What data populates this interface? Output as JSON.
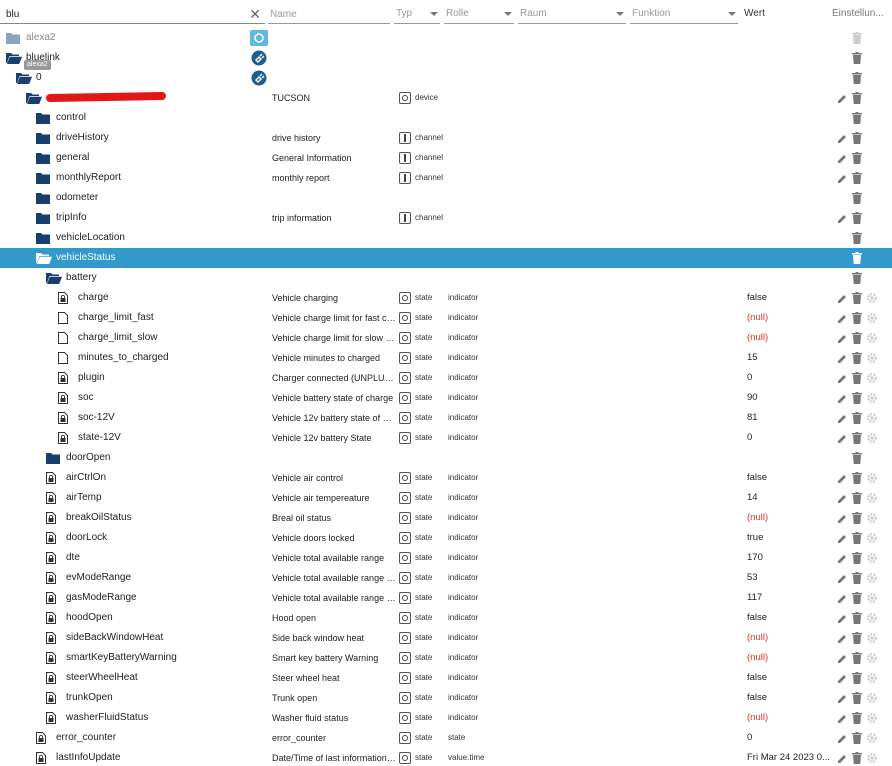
{
  "header": {
    "search_value": "blu",
    "clear": "✕",
    "name_placeholder": "Name",
    "typ": "Typ",
    "rolle": "Rolle",
    "raum": "Raum",
    "funktion": "Funktion",
    "wert": "Wert",
    "einstellungen": "Einstellun..."
  },
  "tooltip": "alexa2",
  "rows": [
    {
      "name": "alexa2",
      "indent": 0,
      "folder": "closed-gray",
      "gray": true,
      "status": "refresh"
    },
    {
      "name": "bluelink",
      "indent": 0,
      "folder": "open",
      "status": "plug"
    },
    {
      "name": "0",
      "indent": 1,
      "folder": "open",
      "status": "plug"
    },
    {
      "name": "[redacted]",
      "indent": 2,
      "folder": "open",
      "desc": "TUCSON",
      "type": "device",
      "redacted": true,
      "edit": true
    },
    {
      "name": "control",
      "indent": 3,
      "folder": "closed"
    },
    {
      "name": "driveHistory",
      "indent": 3,
      "folder": "closed",
      "desc": "drive history",
      "type": "channel",
      "edit": true
    },
    {
      "name": "general",
      "indent": 3,
      "folder": "closed",
      "desc": "General Information",
      "type": "channel",
      "edit": true
    },
    {
      "name": "monthlyReport",
      "indent": 3,
      "folder": "closed",
      "desc": "monthly report",
      "type": "channel",
      "edit": true
    },
    {
      "name": "odometer",
      "indent": 3,
      "folder": "closed"
    },
    {
      "name": "tripInfo",
      "indent": 3,
      "folder": "closed",
      "desc": "trip information",
      "type": "channel",
      "edit": true
    },
    {
      "name": "vehicleLocation",
      "indent": 3,
      "folder": "closed"
    },
    {
      "name": "vehicleStatus",
      "indent": 3,
      "folder": "open",
      "selected": true
    },
    {
      "name": "battery",
      "indent": 4,
      "folder": "open"
    },
    {
      "name": "charge",
      "indent": 5,
      "file": "lock",
      "desc": "Vehicle charging",
      "type": "state",
      "role": "indicator",
      "value": "false",
      "edit": true,
      "gear": true
    },
    {
      "name": "charge_limit_fast",
      "indent": 5,
      "file": "plain",
      "desc": "Vehicle charge limit for fast ch...",
      "type": "state",
      "role": "indicator",
      "value": "(null)",
      "null": true,
      "edit": true,
      "gear": true
    },
    {
      "name": "charge_limit_slow",
      "indent": 5,
      "file": "plain",
      "desc": "Vehicle charge limit for slow c...",
      "type": "state",
      "role": "indicator",
      "value": "(null)",
      "null": true,
      "edit": true,
      "gear": true
    },
    {
      "name": "minutes_to_charged",
      "indent": 5,
      "file": "plain",
      "desc": "Vehicle minutes to charged",
      "type": "state",
      "role": "indicator",
      "value": "15",
      "edit": true,
      "gear": true
    },
    {
      "name": "plugin",
      "indent": 5,
      "file": "lock",
      "desc": "Charger connected (UNPLUGE...",
      "type": "state",
      "role": "indicator",
      "value": "0",
      "edit": true,
      "gear": true
    },
    {
      "name": "soc",
      "indent": 5,
      "file": "lock",
      "desc": "Vehicle battery state of charge",
      "type": "state",
      "role": "indicator",
      "value": "90",
      "edit": true,
      "gear": true
    },
    {
      "name": "soc-12V",
      "indent": 5,
      "file": "lock",
      "desc": "Vehicle 12v battery state of ch...",
      "type": "state",
      "role": "indicator",
      "value": "81",
      "edit": true,
      "gear": true
    },
    {
      "name": "state-12V",
      "indent": 5,
      "file": "lock",
      "desc": "Vehicle 12v battery State",
      "type": "state",
      "role": "indicator",
      "value": "0",
      "edit": true,
      "gear": true
    },
    {
      "name": "doorOpen",
      "indent": 4,
      "folder": "closed"
    },
    {
      "name": "airCtrlOn",
      "indent": 4,
      "file": "lock",
      "desc": "Vehicle air control",
      "type": "state",
      "role": "indicator",
      "value": "false",
      "edit": true,
      "gear": true
    },
    {
      "name": "airTemp",
      "indent": 4,
      "file": "lock",
      "desc": "Vehicle air tempereature",
      "type": "state",
      "role": "indicator",
      "value": "14",
      "edit": true,
      "gear": true
    },
    {
      "name": "breakOilStatus",
      "indent": 4,
      "file": "lock",
      "desc": "Breal oil status",
      "type": "state",
      "role": "indicator",
      "value": "(null)",
      "null": true,
      "edit": true,
      "gear": true
    },
    {
      "name": "doorLock",
      "indent": 4,
      "file": "lock",
      "desc": "Vehicle doors locked",
      "type": "state",
      "role": "indicator",
      "value": "true",
      "edit": true,
      "gear": true
    },
    {
      "name": "dte",
      "indent": 4,
      "file": "lock",
      "desc": "Vehicle total available range",
      "type": "state",
      "role": "indicator",
      "value": "170",
      "edit": true,
      "gear": true
    },
    {
      "name": "evModeRange",
      "indent": 4,
      "file": "lock",
      "desc": "Vehicle total available range fo...",
      "type": "state",
      "role": "indicator",
      "value": "53",
      "edit": true,
      "gear": true
    },
    {
      "name": "gasModeRange",
      "indent": 4,
      "file": "lock",
      "desc": "Vehicle total available range fo...",
      "type": "state",
      "role": "indicator",
      "value": "117",
      "edit": true,
      "gear": true
    },
    {
      "name": "hoodOpen",
      "indent": 4,
      "file": "lock",
      "desc": "Hood open",
      "type": "state",
      "role": "indicator",
      "value": "false",
      "edit": true,
      "gear": true
    },
    {
      "name": "sideBackWindowHeat",
      "indent": 4,
      "file": "lock",
      "desc": "Side back window heat",
      "type": "state",
      "role": "indicator",
      "value": "(null)",
      "null": true,
      "edit": true,
      "gear": true
    },
    {
      "name": "smartKeyBatteryWarning",
      "indent": 4,
      "file": "lock",
      "desc": "Smart key battery Warning",
      "type": "state",
      "role": "indicator",
      "value": "(null)",
      "null": true,
      "edit": true,
      "gear": true
    },
    {
      "name": "steerWheelHeat",
      "indent": 4,
      "file": "lock",
      "desc": "Steer wheel heat",
      "type": "state",
      "role": "indicator",
      "value": "false",
      "edit": true,
      "gear": true
    },
    {
      "name": "trunkOpen",
      "indent": 4,
      "file": "lock",
      "desc": "Trunk open",
      "type": "state",
      "role": "indicator",
      "value": "false",
      "edit": true,
      "gear": true
    },
    {
      "name": "washerFluidStatus",
      "indent": 4,
      "file": "lock",
      "desc": "Washer fluid status",
      "type": "state",
      "role": "indicator",
      "value": "(null)",
      "null": true,
      "edit": true,
      "gear": true
    },
    {
      "name": "error_counter",
      "indent": 3,
      "file": "lock",
      "desc": "error_counter",
      "type": "state",
      "role": "state",
      "value": "0",
      "edit": true,
      "gear": true
    },
    {
      "name": "lastInfoUpdate",
      "indent": 3,
      "file": "lock",
      "desc": "Date/Time of last information ...",
      "type": "state",
      "role": "value.time",
      "value": "Fri Mar 24 2023 0...",
      "edit": true,
      "gear": true
    }
  ],
  "colors": {
    "selected": "#3399cc",
    "folder": "#1a3e6e",
    "null": "#e03030"
  }
}
